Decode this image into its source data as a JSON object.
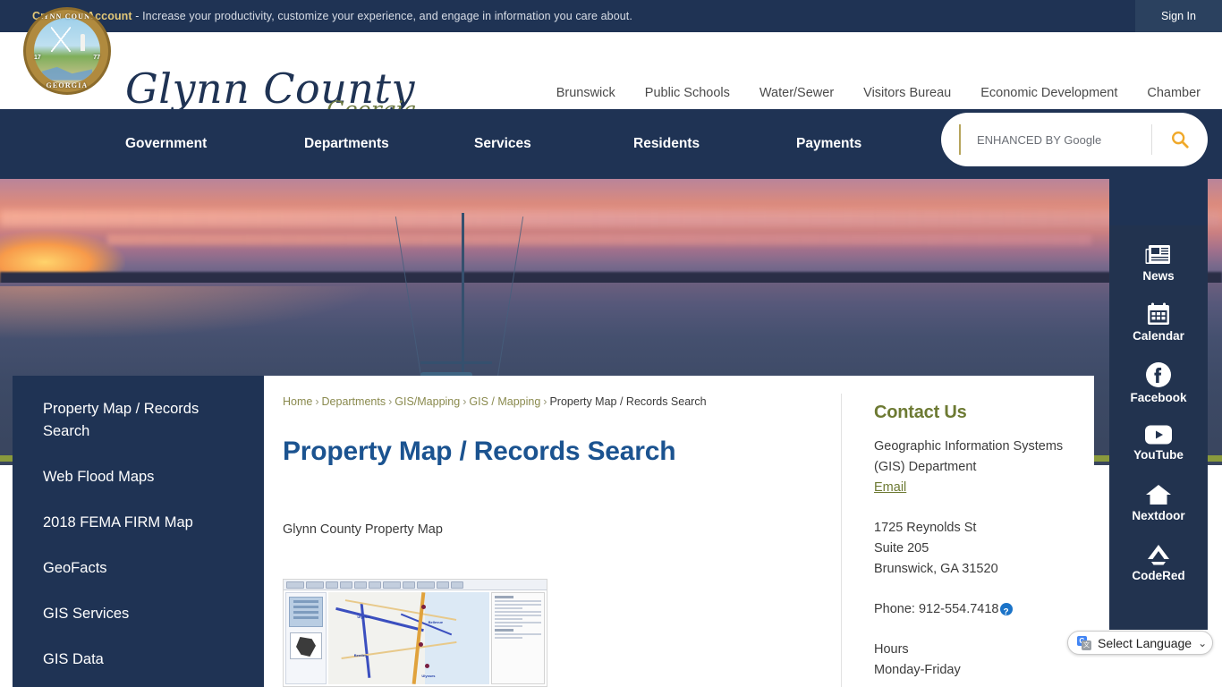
{
  "topbar": {
    "cta": "Create an Account",
    "message": " - Increase your productivity, customize your experience, and engage in information you care about.",
    "signin": "Sign In"
  },
  "brand": {
    "name": "Glynn County",
    "state": "Georgia",
    "seal_top": "GLYNN COUNTY",
    "seal_bottom": "GEORGIA",
    "seal_year_left": "17",
    "seal_year_right": "77"
  },
  "toplinks": [
    {
      "label": "Brunswick"
    },
    {
      "label": "Public Schools"
    },
    {
      "label": "Water/Sewer"
    },
    {
      "label": "Visitors Bureau"
    },
    {
      "label": "Economic Development"
    },
    {
      "label": "Chamber"
    }
  ],
  "mainnav": [
    {
      "label": "Government"
    },
    {
      "label": "Departments"
    },
    {
      "label": "Services"
    },
    {
      "label": "Residents"
    },
    {
      "label": "Payments"
    }
  ],
  "search": {
    "placeholder": "ENHANCED BY Google",
    "value": "",
    "icon": "search-icon",
    "icon_color": "#f0a92a"
  },
  "leftnav": {
    "items": [
      {
        "label": "Property Map / Records Search",
        "active": true
      },
      {
        "label": "Web Flood Maps",
        "active": false
      },
      {
        "label": "2018 FEMA FIRM Map",
        "active": false
      },
      {
        "label": "GeoFacts",
        "active": false
      },
      {
        "label": "GIS Services",
        "active": false
      },
      {
        "label": "GIS Data",
        "active": false
      }
    ]
  },
  "breadcrumb": {
    "items": [
      {
        "label": "Home",
        "current": false
      },
      {
        "label": "Departments",
        "current": false
      },
      {
        "label": "GIS/Mapping",
        "current": false
      },
      {
        "label": "GIS / Mapping",
        "current": false
      },
      {
        "label": "Property Map / Records Search",
        "current": true
      }
    ],
    "separator": "›"
  },
  "main": {
    "title": "Property Map / Records Search",
    "body_text": "Glynn County Property Map",
    "thumbnail_alt": "Glynn County Property Map application screenshot"
  },
  "contact": {
    "heading": "Contact Us",
    "dept_line1": "Geographic Information Systems",
    "dept_line2": "(GIS) Department",
    "email_label": "Email",
    "address_line1": "1725 Reynolds St",
    "address_line2": "Suite 205",
    "address_line3": "Brunswick, GA 31520",
    "phone_label": "Phone: 912-554.7418",
    "phone_icon": "tty-relay-icon",
    "hours_label": "Hours",
    "hours_days": "Monday-Friday"
  },
  "social": {
    "items": [
      {
        "label": "News",
        "icon": "newspaper-icon"
      },
      {
        "label": "Calendar",
        "icon": "calendar-icon"
      },
      {
        "label": "Facebook",
        "icon": "facebook-icon"
      },
      {
        "label": "YouTube",
        "icon": "youtube-icon"
      },
      {
        "label": "Nextdoor",
        "icon": "nextdoor-house-icon"
      },
      {
        "label": "CodeRed",
        "icon": "coderad-triangle-icon"
      }
    ]
  },
  "translate": {
    "label": "Select Language",
    "caret": "⌄",
    "icon": "google-translate-icon",
    "icon_letter_primary": "G",
    "icon_letter_secondary": "文"
  },
  "colors": {
    "navy": "#1f3354",
    "olive": "#8a9a3c",
    "title_blue": "#1b5390",
    "gold": "#e3c878",
    "contact_green": "#6d7a33"
  }
}
